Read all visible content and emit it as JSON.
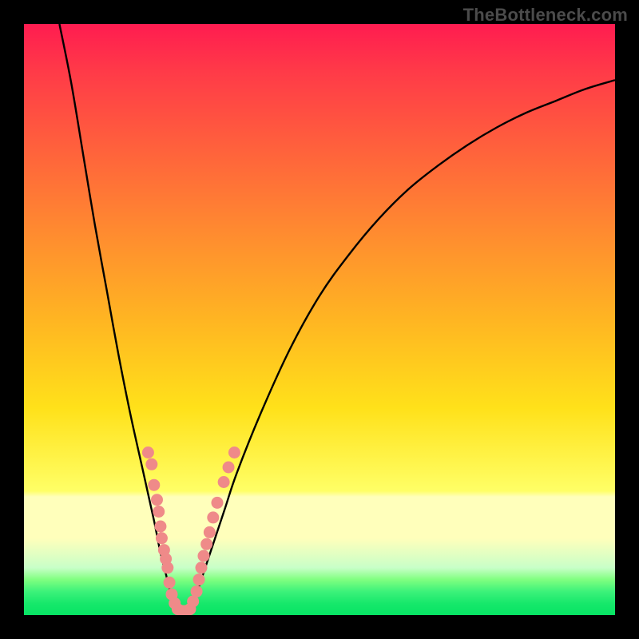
{
  "watermark": "TheBottleneck.com",
  "chart_data": {
    "type": "line",
    "title": "",
    "xlabel": "",
    "ylabel": "",
    "xlim": [
      0,
      100
    ],
    "ylim": [
      0,
      100
    ],
    "grid": false,
    "legend": false,
    "series": [
      {
        "name": "left-curve",
        "x": [
          6,
          8,
          10,
          12,
          14,
          16,
          18,
          20,
          22,
          23,
          24,
          25,
          26
        ],
        "values": [
          100,
          90,
          78,
          66,
          55,
          44,
          34,
          25,
          16,
          11,
          7,
          3,
          0
        ]
      },
      {
        "name": "right-curve",
        "x": [
          28,
          29,
          30,
          32,
          34,
          36,
          40,
          45,
          50,
          55,
          60,
          65,
          70,
          75,
          80,
          85,
          90,
          95,
          100
        ],
        "values": [
          0,
          3,
          6,
          12,
          18,
          24,
          34,
          45,
          54,
          61,
          67,
          72,
          76,
          79.5,
          82.5,
          85,
          87,
          89,
          90.5
        ]
      }
    ],
    "scatter": {
      "name": "dots",
      "color": "#ef8a89",
      "points": [
        {
          "x": 21.0,
          "y": 27.5
        },
        {
          "x": 21.6,
          "y": 25.5
        },
        {
          "x": 22.0,
          "y": 22.0
        },
        {
          "x": 22.5,
          "y": 19.5
        },
        {
          "x": 22.8,
          "y": 17.5
        },
        {
          "x": 23.1,
          "y": 15.0
        },
        {
          "x": 23.3,
          "y": 13.0
        },
        {
          "x": 23.7,
          "y": 11.0
        },
        {
          "x": 24.0,
          "y": 9.5
        },
        {
          "x": 24.3,
          "y": 8.0
        },
        {
          "x": 24.6,
          "y": 5.5
        },
        {
          "x": 25.0,
          "y": 3.5
        },
        {
          "x": 25.5,
          "y": 2.0
        },
        {
          "x": 26.0,
          "y": 1.0
        },
        {
          "x": 26.7,
          "y": 0.7
        },
        {
          "x": 27.4,
          "y": 0.7
        },
        {
          "x": 28.1,
          "y": 1.0
        },
        {
          "x": 28.6,
          "y": 2.3
        },
        {
          "x": 29.2,
          "y": 4.0
        },
        {
          "x": 29.6,
          "y": 6.0
        },
        {
          "x": 30.0,
          "y": 8.0
        },
        {
          "x": 30.4,
          "y": 10.0
        },
        {
          "x": 30.9,
          "y": 12.0
        },
        {
          "x": 31.4,
          "y": 14.0
        },
        {
          "x": 32.0,
          "y": 16.5
        },
        {
          "x": 32.7,
          "y": 19.0
        },
        {
          "x": 33.8,
          "y": 22.5
        },
        {
          "x": 34.6,
          "y": 25.0
        },
        {
          "x": 35.6,
          "y": 27.5
        }
      ]
    },
    "background_gradient": {
      "stops": [
        {
          "pos": 0,
          "color": "#ff1c50"
        },
        {
          "pos": 35,
          "color": "#ff8a30"
        },
        {
          "pos": 65,
          "color": "#ffe11a"
        },
        {
          "pos": 80,
          "color": "#ffffbb"
        },
        {
          "pos": 94,
          "color": "#80ff80"
        },
        {
          "pos": 100,
          "color": "#07e464"
        }
      ]
    }
  }
}
